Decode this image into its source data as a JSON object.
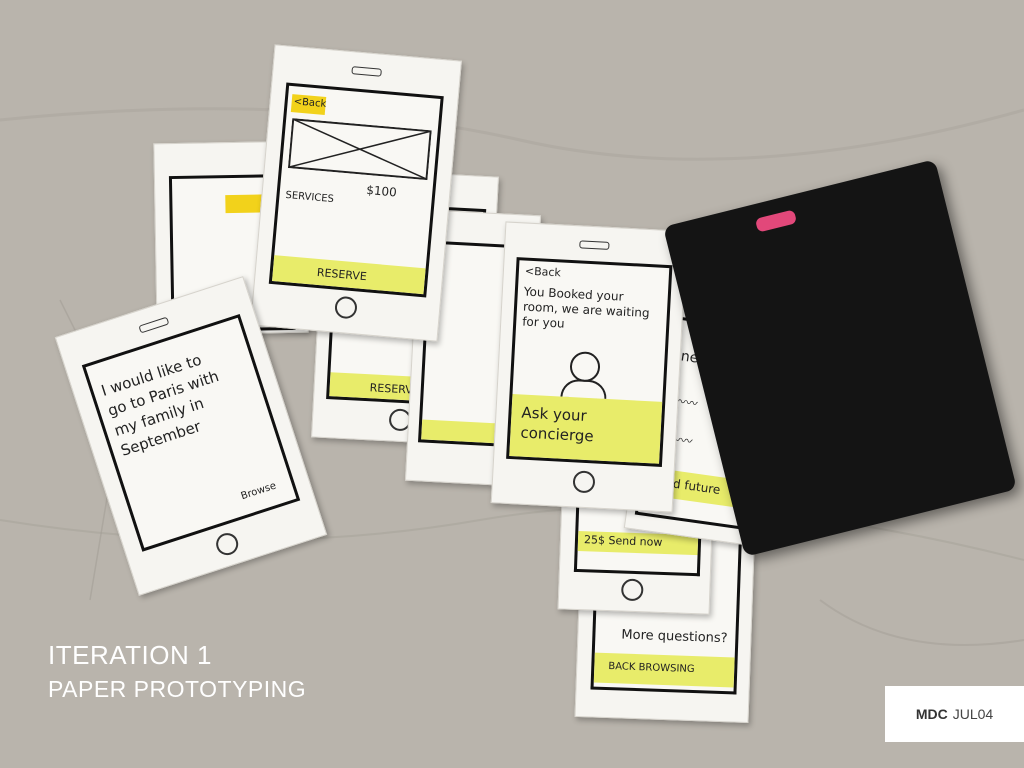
{
  "caption": {
    "title": "ITERATION 1",
    "subtitle": "PAPER PROTOTYPING"
  },
  "badge": {
    "code": "MDC",
    "date": "JUL04"
  },
  "sketches": {
    "top_back": "<Back",
    "top_services": "SERVICES",
    "top_price": "$100",
    "top_reserve": "RESERVE",
    "middle_reserve": "RESERVE",
    "left_text": "I would like to go to Paris with my family in September",
    "left_browse": "Browse",
    "confirm_back": "<Back",
    "confirm_text": "You Booked your room, we are waiting for you",
    "confirm_cta": "Ask your concierge",
    "right_jones": "Jones,",
    "right_send": "Send future",
    "bottom_send": "25$ Send now",
    "bottom_question": "More questions?",
    "bottom_back": "BACK BROWSING"
  }
}
